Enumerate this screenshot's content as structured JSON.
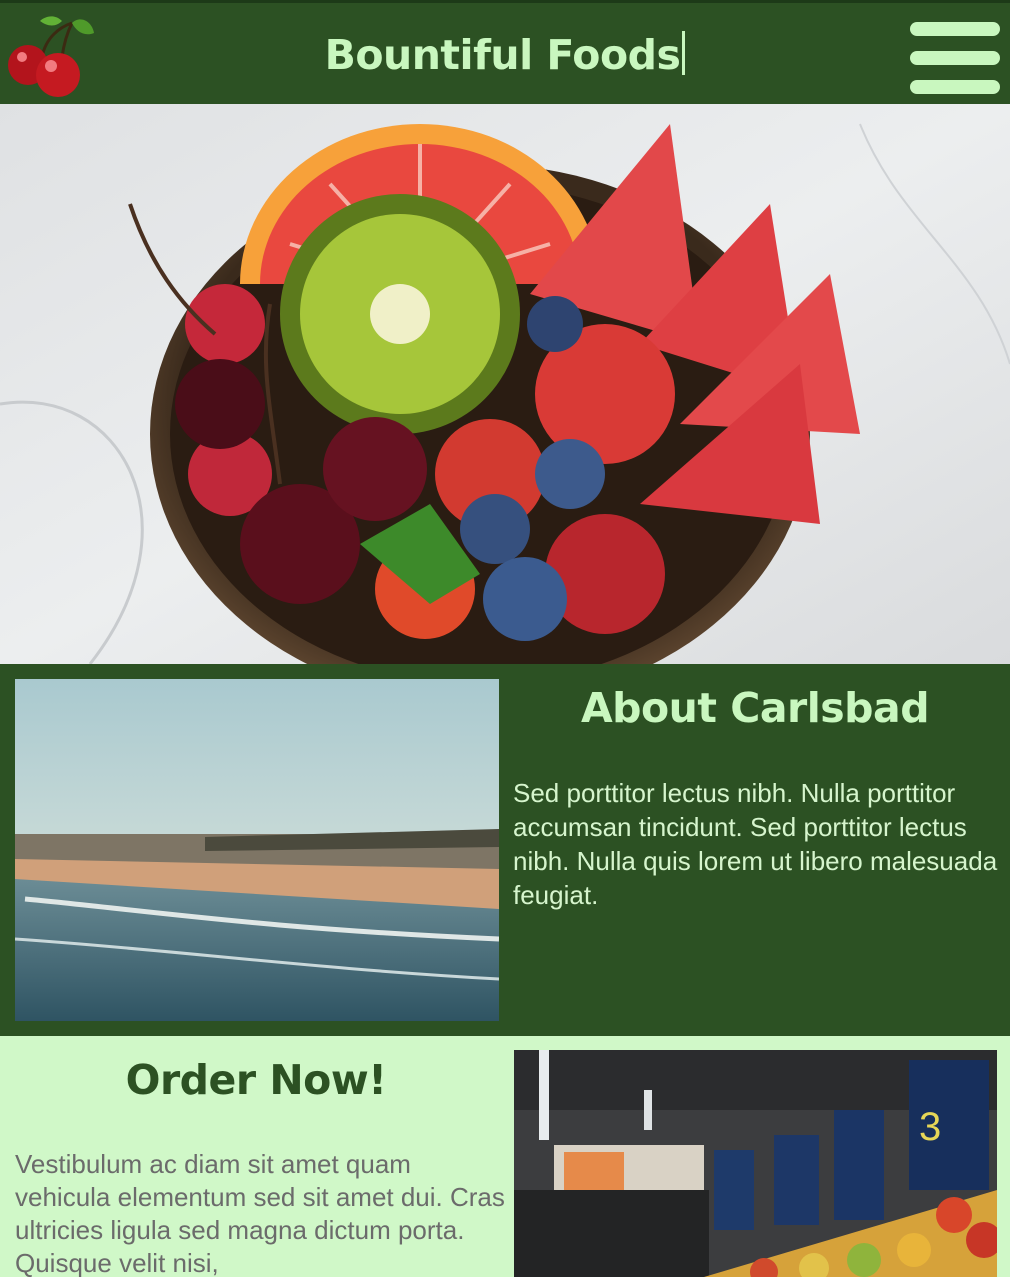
{
  "header": {
    "brand": "Bountiful Foods",
    "logo_icon": "cherries-icon",
    "menu_icon": "hamburger-menu-icon",
    "background": "#2c5123",
    "text_color": "#c9f7bf"
  },
  "hero": {
    "image": "fruit-bowl-photo"
  },
  "about": {
    "title": "About Carlsbad",
    "body": "Sed porttitor lectus nibh. Nulla porttitor accumsan tincidunt. Sed porttitor lectus nibh. Nulla quis lorem ut libero malesuada feugiat.",
    "image": "beach-photo"
  },
  "order": {
    "title": "Order Now!",
    "body": "Vestibulum ac diam sit amet quam vehicula elementum sed sit amet dui. Cras ultricies ligula sed magna dictum porta. Quisque velit nisi,",
    "image": "grocery-produce-photo",
    "background": "#d0f8c8"
  }
}
